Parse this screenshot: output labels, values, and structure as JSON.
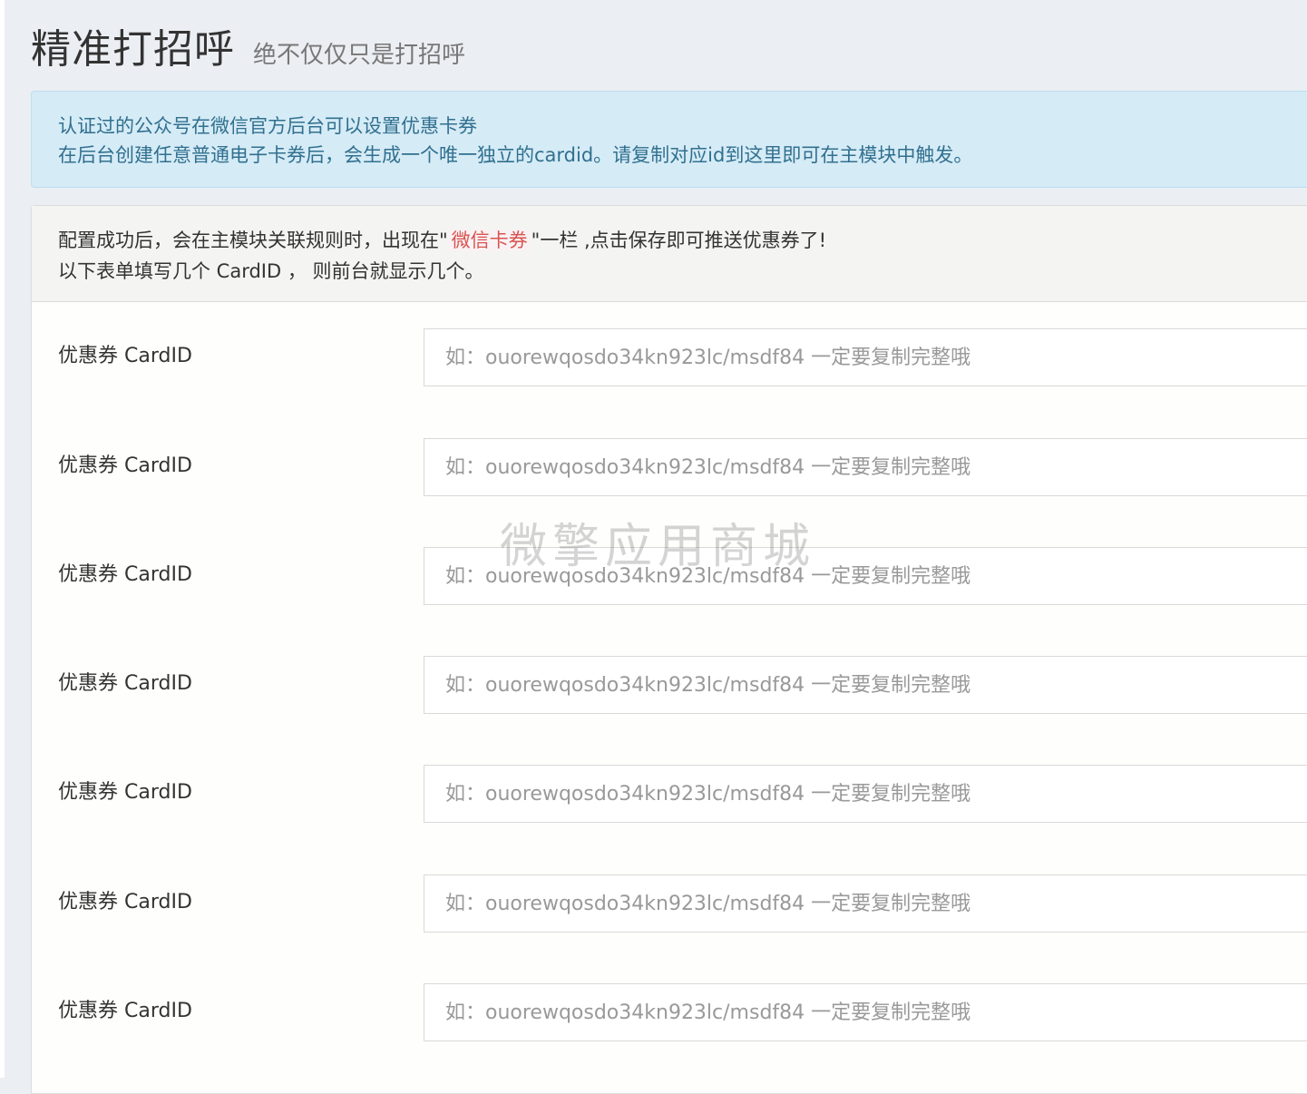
{
  "header": {
    "title": "精准打招呼",
    "subtitle": "绝不仅仅只是打招呼"
  },
  "alert": {
    "line1": "认证过的公众号在微信官方后台可以设置优惠卡券",
    "line2": "在后台创建任意普通电子卡券后，会生成一个唯一独立的cardid。请复制对应id到这里即可在主模块中触发。"
  },
  "panel": {
    "line1_prefix": "配置成功后，会在主模块关联规则时，出现在\"",
    "line1_highlight": "微信卡券",
    "line1_suffix": "\"一栏 ,点击保存即可推送优惠券了!",
    "line2": "以下表单填写几个 CardID ， 则前台就显示几个。"
  },
  "form": {
    "rows": [
      {
        "label": "优惠券 CardID",
        "placeholder": "如：ouorewqosdo34kn923lc/msdf84 一定要复制完整哦",
        "value": ""
      },
      {
        "label": "优惠券 CardID",
        "placeholder": "如：ouorewqosdo34kn923lc/msdf84 一定要复制完整哦",
        "value": ""
      },
      {
        "label": "优惠券 CardID",
        "placeholder": "如：ouorewqosdo34kn923lc/msdf84 一定要复制完整哦",
        "value": ""
      },
      {
        "label": "优惠券 CardID",
        "placeholder": "如：ouorewqosdo34kn923lc/msdf84 一定要复制完整哦",
        "value": ""
      },
      {
        "label": "优惠券 CardID",
        "placeholder": "如：ouorewqosdo34kn923lc/msdf84 一定要复制完整哦",
        "value": ""
      },
      {
        "label": "优惠券 CardID",
        "placeholder": "如：ouorewqosdo34kn923lc/msdf84 一定要复制完整哦",
        "value": ""
      },
      {
        "label": "优惠券 CardID",
        "placeholder": "如：ouorewqosdo34kn923lc/msdf84 一定要复制完整哦",
        "value": ""
      }
    ]
  },
  "watermark": "微擎应用商城",
  "colors": {
    "alert_bg": "#d5ebf6",
    "alert_text": "#31708f",
    "highlight": "#d9534f",
    "page_bg": "#ebeef2"
  }
}
